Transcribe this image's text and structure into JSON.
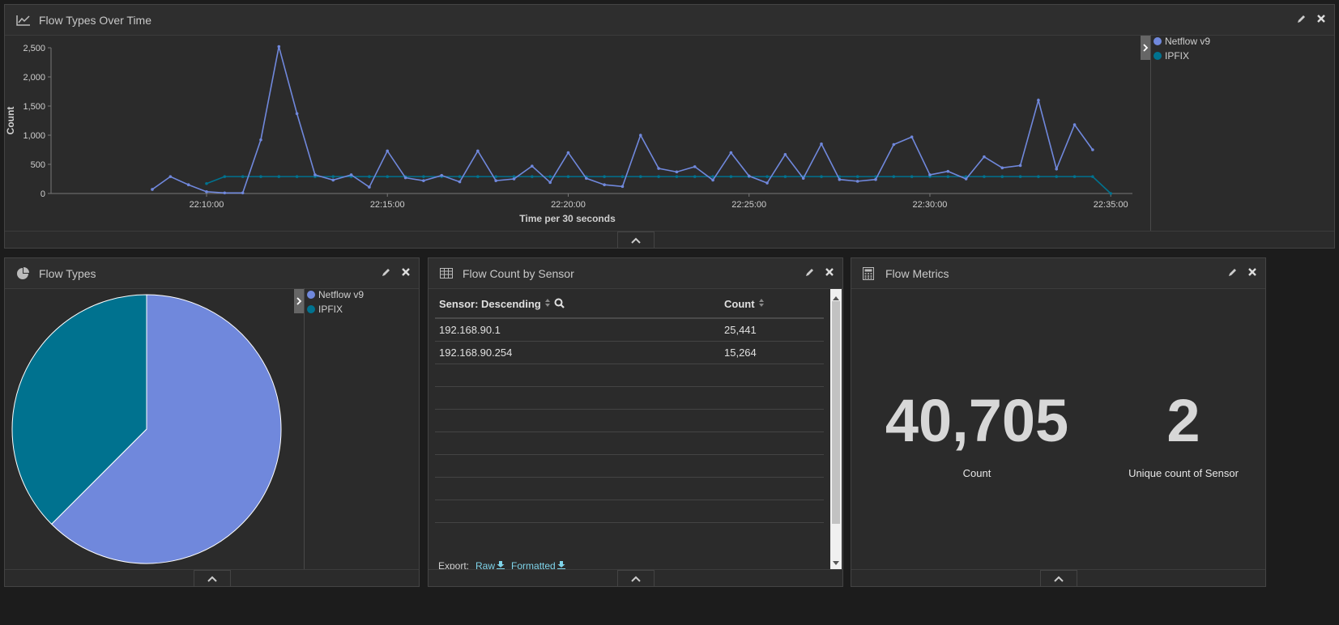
{
  "flow_types_over_time": {
    "title": "Flow Types Over Time",
    "legend": [
      {
        "name": "Netflow v9",
        "color": "#7088dc"
      },
      {
        "name": "IPFIX",
        "color": "#00728f"
      }
    ]
  },
  "flow_types": {
    "title": "Flow Types",
    "legend": [
      {
        "name": "Netflow v9",
        "color": "#7088dc"
      },
      {
        "name": "IPFIX",
        "color": "#00728f"
      }
    ]
  },
  "flow_count_by_sensor": {
    "title": "Flow Count by Sensor",
    "columns": [
      "Sensor: Descending",
      "Count"
    ],
    "rows": [
      {
        "sensor": "192.168.90.1",
        "count": "25,441"
      },
      {
        "sensor": "192.168.90.254",
        "count": "15,264"
      }
    ],
    "export_label": "Export:",
    "export_raw": "Raw",
    "export_formatted": "Formatted"
  },
  "flow_metrics": {
    "title": "Flow Metrics",
    "metrics": [
      {
        "value": "40,705",
        "label": "Count"
      },
      {
        "value": "2",
        "label": "Unique count of Sensor"
      }
    ]
  },
  "chart_data": [
    {
      "type": "line",
      "title": "Flow Types Over Time",
      "xlabel": "Time per 30 seconds",
      "ylabel": "Count",
      "ylim": [
        0,
        2500
      ],
      "yticks": [
        "0",
        "500",
        "1,000",
        "1,500",
        "2,000",
        "2,500"
      ],
      "xticks": [
        "22:10:00",
        "22:15:00",
        "22:20:00",
        "22:25:00",
        "22:30:00",
        "22:35:00"
      ],
      "xlim_minutes": [
        -4.3,
        25.6
      ],
      "grid": false,
      "legend": "right",
      "x_minutes_from_22_10": [
        -1.5,
        -1,
        -0.5,
        0,
        0.5,
        1,
        1.5,
        2,
        2.5,
        3,
        3.5,
        4,
        4.5,
        5,
        5.5,
        6,
        6.5,
        7,
        7.5,
        8,
        8.5,
        9,
        9.5,
        10,
        10.5,
        11,
        11.5,
        12,
        12.5,
        13,
        13.5,
        14,
        14.5,
        15,
        15.5,
        16,
        16.5,
        17,
        17.5,
        18,
        18.5,
        19,
        19.5,
        20,
        20.5,
        21,
        21.5,
        22,
        22.5,
        23,
        23.5,
        24,
        24.5,
        25
      ],
      "series": [
        {
          "name": "Netflow v9",
          "color": "#7088dc",
          "values": [
            70,
            290,
            150,
            30,
            10,
            10,
            920,
            2520,
            1370,
            320,
            230,
            320,
            110,
            730,
            270,
            220,
            310,
            200,
            730,
            220,
            250,
            470,
            190,
            700,
            260,
            150,
            120,
            1000,
            430,
            370,
            460,
            230,
            700,
            300,
            180,
            670,
            260,
            850,
            240,
            210,
            240,
            840,
            970,
            320,
            380,
            250,
            630,
            440,
            480,
            1600,
            420,
            1180,
            750,
            null
          ]
        },
        {
          "name": "IPFIX",
          "color": "#00728f",
          "values": [
            null,
            null,
            null,
            170,
            290,
            290,
            290,
            290,
            290,
            290,
            290,
            290,
            290,
            290,
            290,
            290,
            290,
            290,
            290,
            290,
            290,
            290,
            290,
            290,
            290,
            290,
            290,
            290,
            290,
            290,
            290,
            290,
            290,
            290,
            290,
            290,
            290,
            290,
            290,
            290,
            290,
            290,
            290,
            290,
            290,
            290,
            290,
            290,
            290,
            290,
            290,
            290,
            290,
            0
          ]
        }
      ]
    },
    {
      "type": "pie",
      "title": "Flow Types",
      "legend": "right",
      "categories": [
        "Netflow v9",
        "IPFIX"
      ],
      "values": [
        25441,
        15264
      ],
      "colors": [
        "#7088dc",
        "#00728f"
      ]
    }
  ]
}
